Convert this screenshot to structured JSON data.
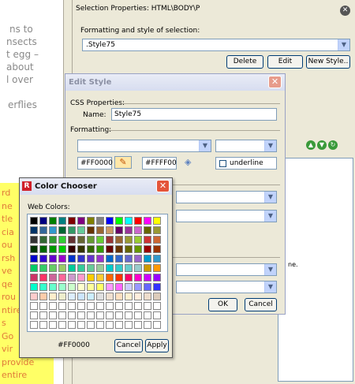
{
  "document": {
    "lines": [
      "ns to",
      "nsects",
      "t egg –",
      "about",
      "l over",
      "",
      "erflies"
    ],
    "highlight_lines": [
      "rd",
      "ne",
      "tle",
      "cia",
      "ou",
      "rsh",
      "ve",
      "qe",
      "rou",
      "ntire",
      "s",
      "Go",
      "vir",
      "provide",
      "entire"
    ]
  },
  "panel": {
    "title": "Selection Properties:  HTML\\BODY\\P",
    "formatting_label": "Formatting and style of selection:",
    "style_value": ".Style75",
    "delete_label": "Delete",
    "edit_label": "Edit",
    "new_style_label": "New Style..",
    "content_fragment": "ne."
  },
  "edit_style": {
    "title": "Edit Style",
    "css_properties_label": "CSS Properties:",
    "name_label": "Name:",
    "name_value": "Style75",
    "formatting_label": "Formatting:",
    "fg_color": "#FF0000",
    "bg_color": "#FFFF00",
    "underline_label": "underline",
    "ok_label": "OK",
    "cancel_label": "Cancel"
  },
  "color_chooser": {
    "title": "Color Chooser",
    "web_colors_label": "Web Colors:",
    "current_value": "#FF0000",
    "cancel_label": "Cancel",
    "apply_label": "Apply",
    "swatches": [
      "#000000",
      "#000080",
      "#008000",
      "#008080",
      "#800000",
      "#800080",
      "#808000",
      "#808080",
      "#0000ff",
      "#00ff00",
      "#00ffff",
      "#ff0000",
      "#ff00ff",
      "#ffff00",
      "#003366",
      "#336699",
      "#3399cc",
      "#006633",
      "#339966",
      "#66cc99",
      "#663300",
      "#996633",
      "#cc9966",
      "#660066",
      "#993399",
      "#cc66cc",
      "#666600",
      "#999933",
      "#333333",
      "#336633",
      "#339933",
      "#33cc33",
      "#663333",
      "#666633",
      "#669933",
      "#66cc33",
      "#993333",
      "#996633",
      "#999933",
      "#99cc33",
      "#cc3333",
      "#cc6633",
      "#003300",
      "#006600",
      "#009900",
      "#00cc00",
      "#330000",
      "#333300",
      "#336600",
      "#339900",
      "#660000",
      "#663300",
      "#666600",
      "#669900",
      "#990000",
      "#993300",
      "#0000cc",
      "#3300cc",
      "#6600cc",
      "#9900cc",
      "#0033cc",
      "#3333cc",
      "#6633cc",
      "#9933cc",
      "#0066cc",
      "#3366cc",
      "#6666cc",
      "#9966cc",
      "#0099cc",
      "#3399cc",
      "#00cc66",
      "#33cc66",
      "#66cc66",
      "#99cc66",
      "#00cc99",
      "#33cc99",
      "#66cc99",
      "#99cc99",
      "#00cccc",
      "#33cccc",
      "#66cccc",
      "#99cccc",
      "#cc9900",
      "#ff9900",
      "#cc3366",
      "#ff3366",
      "#cc6699",
      "#ff6699",
      "#cc99cc",
      "#ff99cc",
      "#ffcc00",
      "#ffcc33",
      "#ff6600",
      "#ff3300",
      "#ff0066",
      "#ff00cc",
      "#cc00ff",
      "#9900ff",
      "#00ffcc",
      "#33ffcc",
      "#66ffcc",
      "#99ffcc",
      "#ccffcc",
      "#ffffcc",
      "#ffff99",
      "#ffff66",
      "#ff99ff",
      "#ff66ff",
      "#ccccff",
      "#9999ff",
      "#6666ff",
      "#3333ff",
      "#ffcccc",
      "#ffccaa",
      "#ffeecc",
      "#eeeecc",
      "#ddeeff",
      "#cce5ff",
      "#cceeff",
      "#e0e0e0",
      "#f0e0d0",
      "#ffe0c0",
      "#fff0d0",
      "#ffeedd",
      "#eeddcc",
      "#ddccbb",
      "#ffffff",
      "#ffffff",
      "#ffffff",
      "#ffffff",
      "#ffffff",
      "#ffffff",
      "#ffffff",
      "#ffffff",
      "#ffffff",
      "#ffffff",
      "#ffffff",
      "#ffffff",
      "#ffffff",
      "#ffffff",
      "#ffffff",
      "#ffffff",
      "#ffffff",
      "#ffffff",
      "#ffffff",
      "#ffffff",
      "#ffffff",
      "#ffffff",
      "#ffffff",
      "#ffffff",
      "#ffffff",
      "#ffffff",
      "#ffffff",
      "#ffffff",
      "#ffffff",
      "#ffffff",
      "#ffffff",
      "#ffffff",
      "#ffffff",
      "#ffffff",
      "#ffffff",
      "#ffffff",
      "#ffffff",
      "#ffffff",
      "#ffffff",
      "#ffffff",
      "#ffffff",
      "#ffffff"
    ]
  }
}
